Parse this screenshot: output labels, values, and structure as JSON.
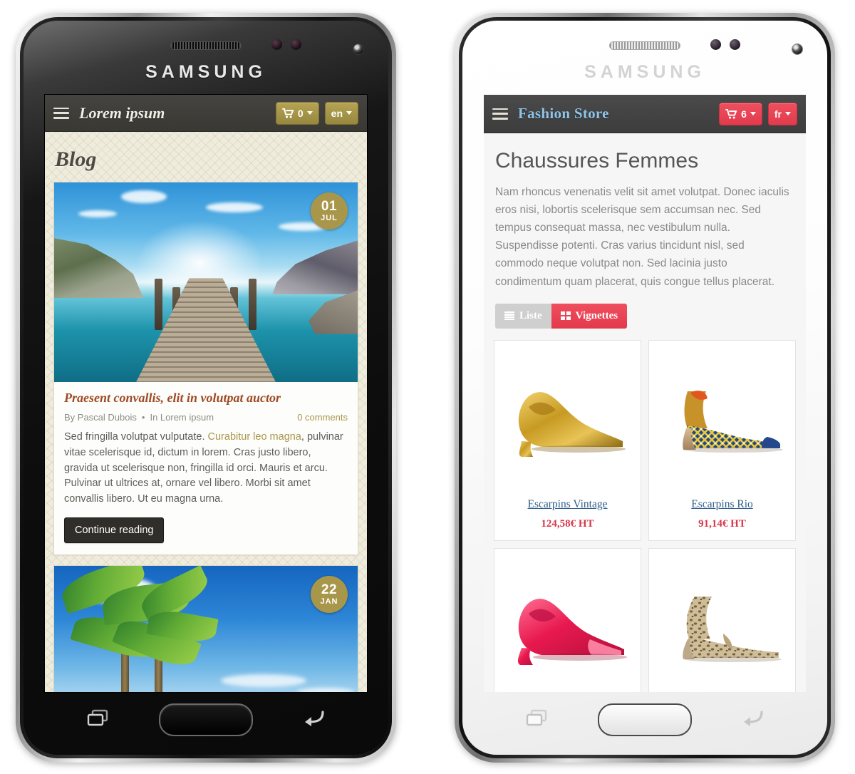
{
  "devices": {
    "brand_logo": "SAMSUNG",
    "nav": {
      "recents_label": "recents",
      "home_label": "home",
      "back_label": "back"
    }
  },
  "left_phone": {
    "color": "black",
    "site": {
      "topbar": {
        "menu_label": "menu",
        "brand": "Lorem ipsum",
        "cart_count": "0",
        "language": "en",
        "accent_color": "#a8974a"
      },
      "page_title": "Blog",
      "posts": [
        {
          "date_day": "01",
          "date_month": "JUL",
          "title": "Praesent convallis, elit in volutpat auctor",
          "author": "By Pascal Dubois",
          "separator": "•",
          "category": "In Lorem ipsum",
          "comments": "0 comments",
          "excerpt_pre": "Sed fringilla volutpat vulputate. ",
          "excerpt_link": "Curabitur leo magna",
          "excerpt_post": ", pulvinar vitae scelerisque id, dictum in lorem. Cras justo libero, gravida ut scelerisque non, fringilla id orci. Mauris et arcu. Pulvinar ut ultrices at, ornare vel libero. Morbi sit amet convallis libero. Ut eu magna urna.",
          "cta": "Continue reading",
          "image_alt": "wooden-pier-over-turquoise-sea"
        },
        {
          "date_day": "22",
          "date_month": "JAN",
          "image_alt": "palm-trees-blue-sky"
        }
      ]
    }
  },
  "right_phone": {
    "color": "white",
    "site": {
      "topbar": {
        "menu_label": "menu",
        "brand": "Fashion Store",
        "cart_count": "6",
        "language": "fr",
        "accent_color": "#e3384b",
        "brand_color": "#8fc4e8"
      },
      "page_title": "Chaussures Femmes",
      "description": "Nam rhoncus venenatis velit sit amet volutpat. Donec iaculis eros nisi, lobortis scelerisque sem accumsan nec. Sed tempus consequat massa, nec vestibulum nulla. Suspendisse potenti. Cras varius tincidunt nisl, sed commodo neque volutpat non. Sed lacinia justo condimentum quam placerat, quis congue tellus placerat.",
      "view_toggle": {
        "list_label": "Liste",
        "grid_label": "Vignettes",
        "active": "Vignettes"
      },
      "products": [
        {
          "name": "Escarpins Vintage",
          "price": "124,58€ HT",
          "image_alt": "gold-metallic-pump"
        },
        {
          "name": "Escarpins Rio",
          "price": "91,14€ HT",
          "image_alt": "african-wax-print-pump"
        },
        {
          "name": "",
          "price": "",
          "image_alt": "pink-patent-peeptoe-pump"
        },
        {
          "name": "",
          "price": "",
          "image_alt": "leopard-print-beige-pump"
        }
      ]
    }
  }
}
